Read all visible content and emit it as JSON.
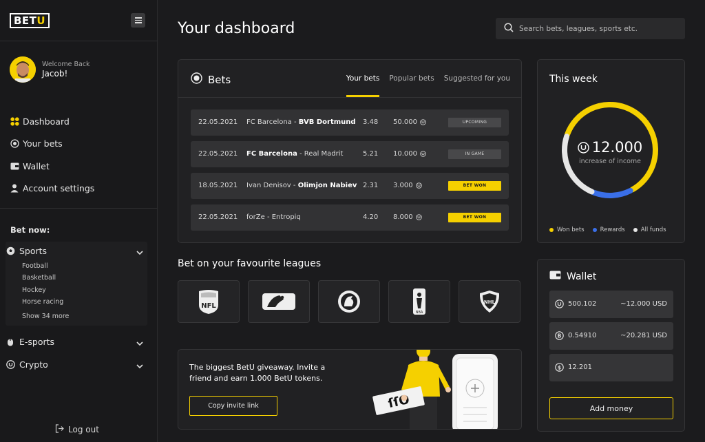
{
  "brand": {
    "logo": "BETU",
    "accent": "#f5d000"
  },
  "user": {
    "welcome": "Welcome Back",
    "name": "Jacob!"
  },
  "nav": [
    {
      "label": "Dashboard",
      "icon": "dashboard-grid-icon"
    },
    {
      "label": "Your bets",
      "icon": "target-icon"
    },
    {
      "label": "Wallet",
      "icon": "wallet-icon"
    },
    {
      "label": "Account settings",
      "icon": "user-icon"
    }
  ],
  "bet_now": {
    "title": "Bet now:",
    "sports": {
      "label": "Sports",
      "items": [
        "Football",
        "Basketball",
        "Hockey",
        "Horse racing"
      ],
      "more": "Show 34 more"
    },
    "esports": {
      "label": "E-sports"
    },
    "crypto": {
      "label": "Crypto"
    }
  },
  "logout": "Log out",
  "page_title": "Your dashboard",
  "search": {
    "placeholder": "Search bets, leagues, sports etc."
  },
  "bets": {
    "title": "Bets",
    "tabs": [
      "Your bets",
      "Popular bets",
      "Suggested for you"
    ],
    "active_tab": "Your bets",
    "rows": [
      {
        "date": "22.05.2021",
        "team_a": "FC Barcelona",
        "team_b": "BVB Dortmund",
        "bold": "b",
        "odds": "3.48",
        "stake": "50.000",
        "status": "UPCOMING",
        "won": false
      },
      {
        "date": "22.05.2021",
        "team_a": "FC Barcelona",
        "team_b": "Real Madrit",
        "bold": "a",
        "odds": "5.21",
        "stake": "10.000",
        "status": "IN GAME",
        "won": false
      },
      {
        "date": "18.05.2021",
        "team_a": "Ivan Denisov",
        "team_b": "Olimjon Nabiev",
        "bold": "b",
        "odds": "2.31",
        "stake": "3.000",
        "status": "BET WON",
        "won": true
      },
      {
        "date": "22.05.2021",
        "team_a": "forZe",
        "team_b": "Entropiq",
        "bold": "none",
        "odds": "4.20",
        "stake": "8.000",
        "status": "BET WON",
        "won": true
      }
    ]
  },
  "leagues": {
    "title": "Bet on your favourite leagues",
    "items": [
      {
        "name": "nfl-logo-icon"
      },
      {
        "name": "mlb-logo-icon"
      },
      {
        "name": "premier-league-logo-icon"
      },
      {
        "name": "nba-logo-icon"
      },
      {
        "name": "nhl-logo-icon"
      }
    ]
  },
  "promo": {
    "line1": "The biggest BetU giveaway. Invite a",
    "line2": "friend and earn 1.000 BetU tokens.",
    "button": "Copy invite link"
  },
  "this_week": {
    "title": "This week",
    "value": "12.000",
    "subtitle": "increase of income",
    "segments": [
      {
        "name": "Won bets",
        "color": "#f5d000",
        "fraction": 0.62
      },
      {
        "name": "Rewards",
        "color": "#3a6fe8",
        "fraction": 0.14
      },
      {
        "name": "All funds",
        "color": "#e6e6e6",
        "fraction": 0.24
      }
    ]
  },
  "wallet": {
    "title": "Wallet",
    "rows": [
      {
        "icon": "betu-coin-icon",
        "amount": "500.102",
        "usd": "~12.000 USD"
      },
      {
        "icon": "bitcoin-icon",
        "amount": "0.54910",
        "usd": "~20.281 USD"
      },
      {
        "icon": "dollar-icon",
        "amount": "12.201",
        "usd": ""
      }
    ],
    "add_button": "Add money"
  }
}
